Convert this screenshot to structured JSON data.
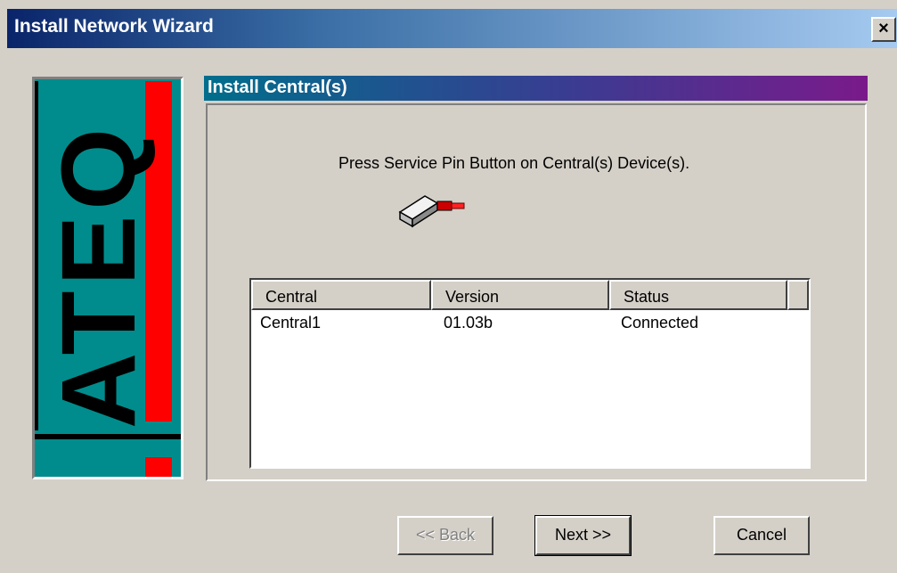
{
  "window": {
    "title": "Install Network Wizard",
    "close_glyph": "×"
  },
  "logo": {
    "brand_text": "ATEQ",
    "colors": {
      "teal": "#008c8c",
      "red": "#ff0000",
      "black": "#000000"
    }
  },
  "section": {
    "title": "Install Central(s)"
  },
  "instruction": "Press Service Pin Button on Central(s) Device(s).",
  "device_icon": "device-with-service-pin-icon",
  "table": {
    "columns": [
      "Central",
      "Version",
      "Status"
    ],
    "rows": [
      {
        "central": "Central1",
        "version": "01.03b",
        "status": "Connected"
      }
    ]
  },
  "buttons": {
    "back": "<< Back",
    "next": "Next >>",
    "cancel": "Cancel"
  }
}
